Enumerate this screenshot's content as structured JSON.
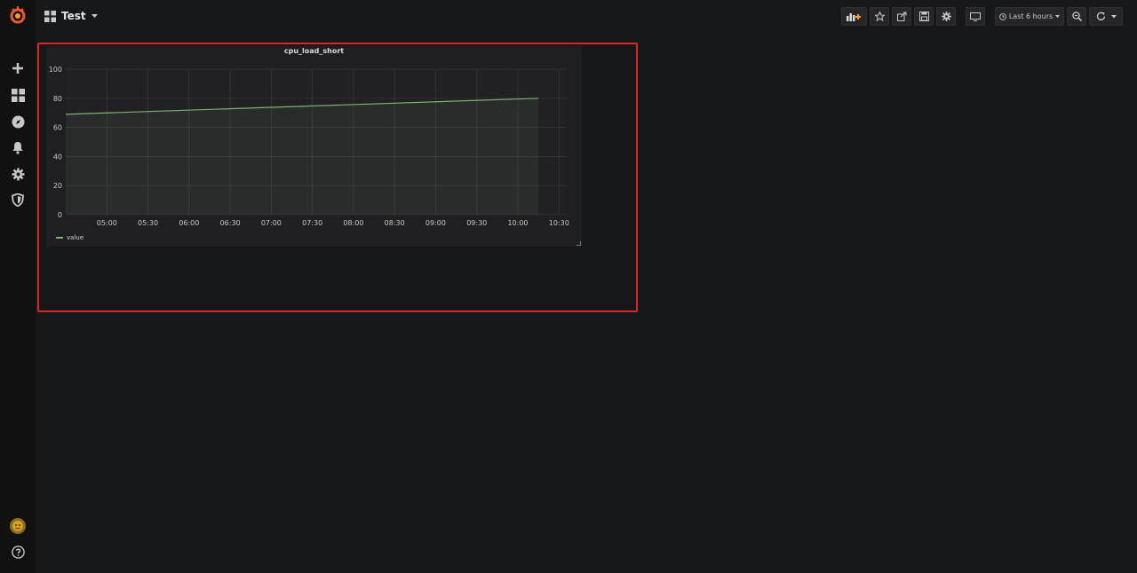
{
  "dashboard": {
    "title": "Test"
  },
  "toolbar": {
    "time_range": "Last 6 hours"
  },
  "panel": {
    "title": "cpu_load_short",
    "legend": [
      {
        "name": "value",
        "color": "#7eb26d"
      }
    ]
  },
  "colors": {
    "series": "#7eb26d",
    "highlight": "#e02424",
    "logo": "#f05a28"
  },
  "chart_data": {
    "type": "line",
    "title": "cpu_load_short",
    "xlabel": "",
    "ylabel": "",
    "ylim": [
      0,
      100
    ],
    "yticks": [
      "0",
      "20",
      "40",
      "60",
      "80",
      "100"
    ],
    "xticks": [
      "05:00",
      "05:30",
      "06:00",
      "06:30",
      "07:00",
      "07:30",
      "08:00",
      "08:30",
      "09:00",
      "09:30",
      "10:00",
      "10:30"
    ],
    "grid": true,
    "legend_position": "bottom-left",
    "series": [
      {
        "name": "value",
        "x": [
          "04:30",
          "10:15"
        ],
        "values": [
          69,
          80
        ]
      }
    ]
  }
}
